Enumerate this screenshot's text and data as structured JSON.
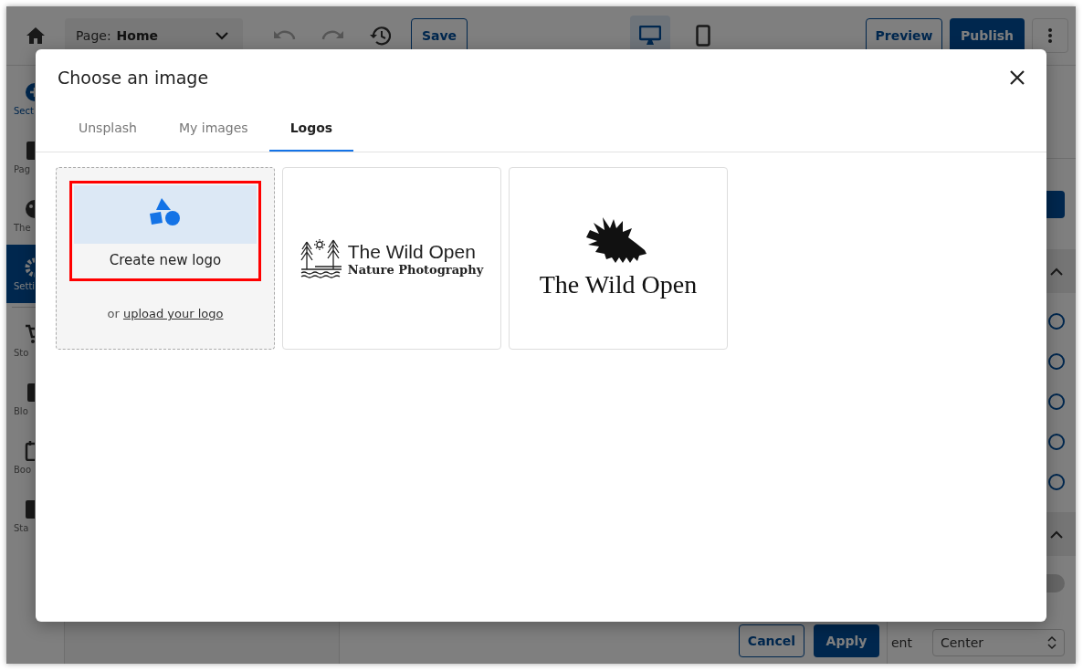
{
  "toolbar": {
    "page_label": "Page:",
    "page_value": "Home",
    "save": "Save",
    "devices": [
      {
        "kind": "desktop",
        "selected": true
      },
      {
        "kind": "mobile",
        "selected": false
      }
    ],
    "preview": "Preview",
    "publish": "Publish"
  },
  "sidebar": {
    "items": [
      {
        "kind": "sections",
        "label": "Sect",
        "selected": false
      },
      {
        "kind": "pages",
        "label": "Pag",
        "selected": false
      },
      {
        "kind": "theme",
        "label": "The",
        "selected": false
      },
      {
        "kind": "settings",
        "label": "Setti",
        "selected": true
      },
      {
        "kind": "store",
        "label": "Sto",
        "selected": false
      },
      {
        "kind": "blog",
        "label": "Blo",
        "selected": false
      },
      {
        "kind": "bookings",
        "label": "Boo",
        "selected": false
      },
      {
        "kind": "stats",
        "label": "Sta",
        "selected": false
      }
    ]
  },
  "right_panel": {
    "radios": [
      {
        "selected": false
      },
      {
        "selected": false
      },
      {
        "selected": false
      },
      {
        "selected": false
      },
      {
        "selected": false
      }
    ],
    "toggle": {
      "on": false
    },
    "alignment_label": "ent",
    "alignment_value": "Center"
  },
  "footer": {
    "cancel": "Cancel",
    "apply": "Apply"
  },
  "dialog": {
    "title": "Choose an image",
    "tabs": [
      {
        "label": "Unsplash",
        "selected": false
      },
      {
        "label": "My images",
        "selected": false
      },
      {
        "label": "Logos",
        "selected": true
      }
    ],
    "create_card": {
      "label": "Create new logo",
      "highlighted": true,
      "alt_prefix": "or",
      "alt_link": "upload your logo"
    },
    "logos": [
      {
        "kind": "nature",
        "title": "The Wild Open",
        "subtitle": "Nature Photography"
      },
      {
        "kind": "porcupine",
        "title": "The Wild Open"
      }
    ]
  }
}
